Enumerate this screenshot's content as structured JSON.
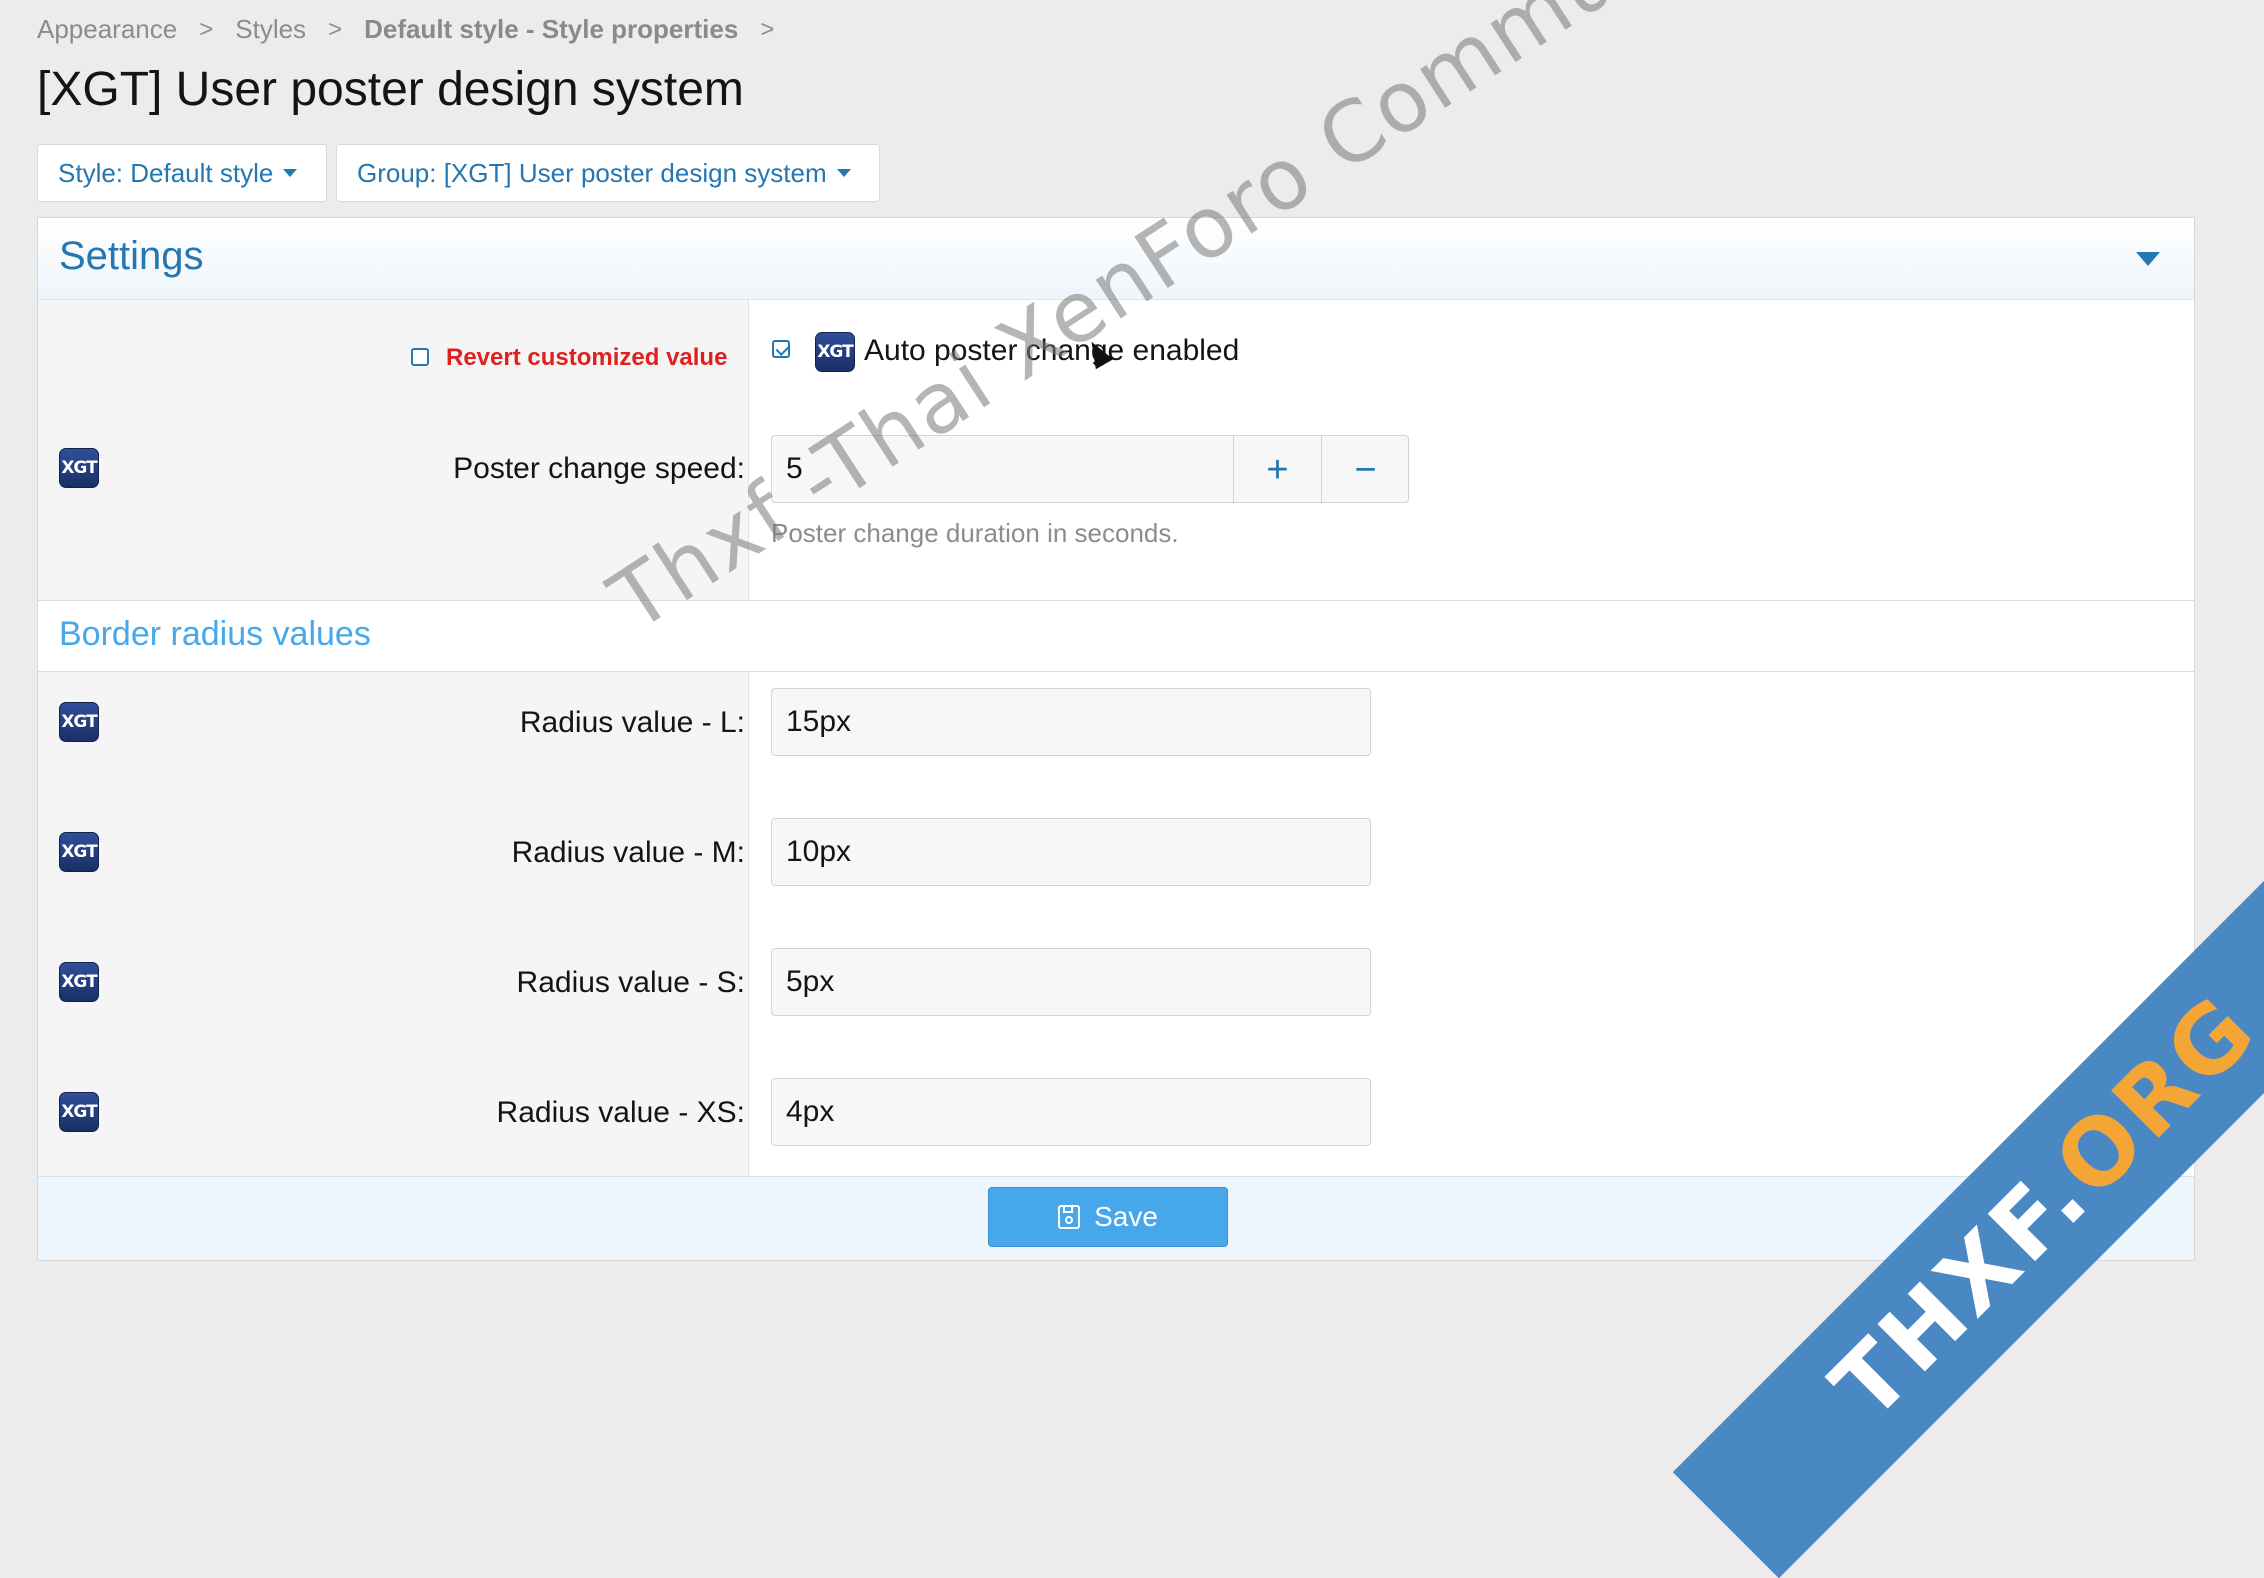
{
  "breadcrumb": [
    "Appearance",
    "Styles",
    "Default style - Style properties"
  ],
  "page_title": "[XGT] User poster design system",
  "filters": {
    "style_label": "Style: Default style",
    "group_label": "Group: [XGT] User poster design system"
  },
  "panel": {
    "title": "Settings",
    "auto_change": {
      "revert_label": "Revert customized value",
      "revert_checked": false,
      "label": "Auto poster change enabled",
      "checked": true
    },
    "speed": {
      "label": "Poster change speed:",
      "value": "5",
      "increment": "+",
      "decrement": "−",
      "hint": "Poster change duration in seconds."
    },
    "border_section": {
      "title": "Border radius values",
      "rows": [
        {
          "label": "Radius value - L:",
          "value": "15px"
        },
        {
          "label": "Radius value - M:",
          "value": "10px"
        },
        {
          "label": "Radius value - S:",
          "value": "5px"
        },
        {
          "label": "Radius value - XS:",
          "value": "4px"
        }
      ]
    },
    "save_label": "Save"
  },
  "icon_text": "XGT",
  "watermark": "Thxf -Thai XenForo Community",
  "ribbon": {
    "main": "THXF.",
    "accent": "ORG"
  },
  "colors": {
    "link_blue": "#2577b1",
    "section_blue": "#47a7eb",
    "revert_red": "#e01f1f",
    "save_blue": "#47a7eb"
  }
}
